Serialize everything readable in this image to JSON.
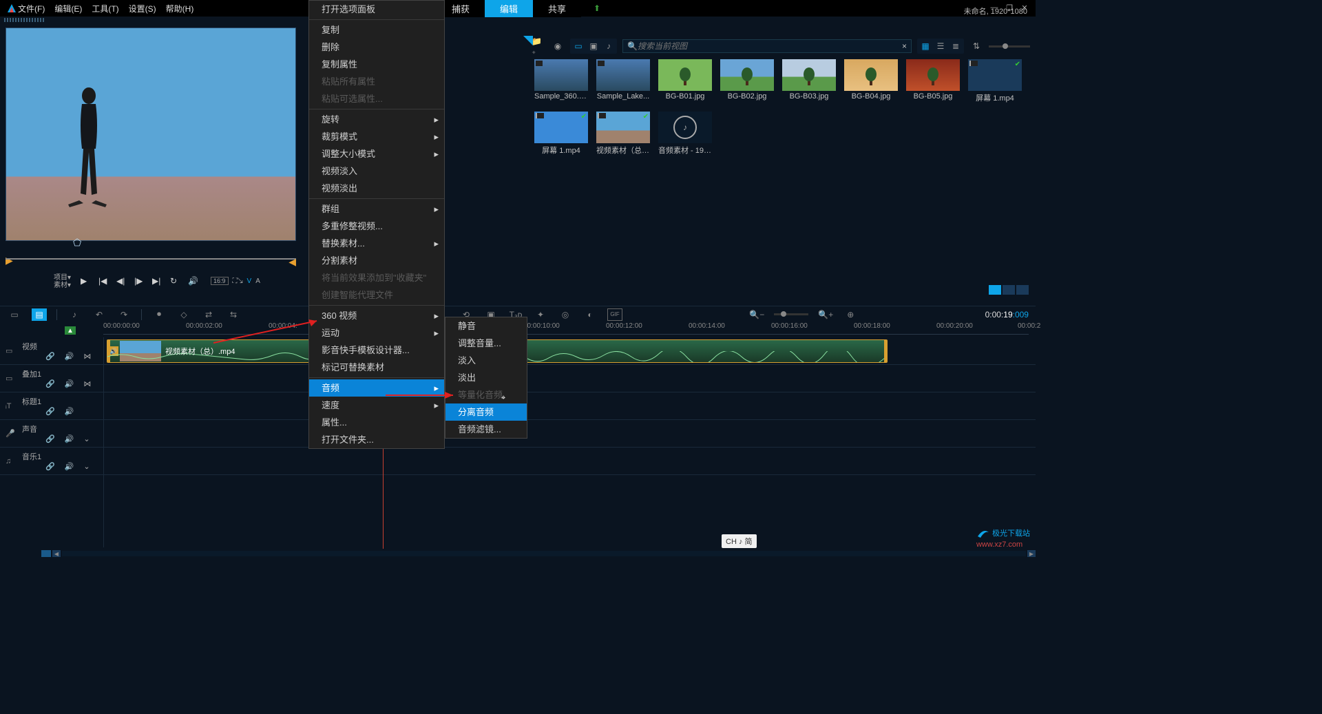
{
  "menu": {
    "file": "文件(F)",
    "edit": "编辑(E)",
    "tool": "工具(T)",
    "setting": "设置(S)",
    "help": "帮助(H)"
  },
  "modes": {
    "capture": "捕获",
    "edit": "编辑",
    "share": "共享"
  },
  "project": {
    "title": "未命名, 1920*1080"
  },
  "search": {
    "placeholder": "搜索当前视图",
    "icon": "search-icon",
    "clear": "×"
  },
  "thumbs": [
    {
      "name": "Sample_360.m...",
      "type": "spherical"
    },
    {
      "name": "Sample_Lake...",
      "type": "spherical"
    },
    {
      "name": "BG-B01.jpg",
      "type": "img",
      "bg": "linear-gradient(#7ab85a,#7ab85a)",
      "tree": true
    },
    {
      "name": "BG-B02.jpg",
      "type": "img",
      "bg": "linear-gradient(#6aa5d6 55%,#5a9a4a 55%)",
      "tree": true
    },
    {
      "name": "BG-B03.jpg",
      "type": "img",
      "bg": "linear-gradient(#b8cce0 55%,#5a9a4a 55%)",
      "tree": true
    },
    {
      "name": "BG-B04.jpg",
      "type": "img",
      "bg": "linear-gradient(#d8a860,#e8c080)",
      "tree": true
    },
    {
      "name": "BG-B05.jpg",
      "type": "img",
      "bg": "linear-gradient(#8a2a1a,#c0502a)",
      "tree": true
    },
    {
      "name": "屏幕 1.mp4",
      "type": "vid",
      "bg": "#1a3a5a",
      "check": true
    },
    {
      "name": "屏幕 1.mp4",
      "type": "vid",
      "bg": "#3a8ad8",
      "check": true
    },
    {
      "name": "视频素材（总）...",
      "type": "vid",
      "bg": "linear-gradient(#5aa5d6 60%,#a0826d 60%)",
      "check": true
    },
    {
      "name": "音频素材 - 196...",
      "type": "audio"
    }
  ],
  "ctx": {
    "open_opts": "打开选项面板",
    "copy": "复制",
    "delete": "删除",
    "copy_attr": "复制属性",
    "paste_all": "粘贴所有属性",
    "paste_opt": "粘贴可选属性...",
    "rotate": "旋转",
    "crop_mode": "裁剪模式",
    "resize_mode": "调整大小模式",
    "fade_in_v": "视频淡入",
    "fade_out_v": "视频淡出",
    "group": "群组",
    "multi_trim": "多重修整视频...",
    "replace": "替换素材...",
    "split": "分割素材",
    "add_fav": "将当前效果添加到\"收藏夹\"",
    "smart_proxy": "创建智能代理文件",
    "v360": "360 视频",
    "motion": "运动",
    "template": "影音快手模板设计器...",
    "mark_replace": "标记可替换素材",
    "audio": "音频",
    "speed": "速度",
    "props": "属性...",
    "open_folder": "打开文件夹..."
  },
  "sub": {
    "mute": "静音",
    "adj_vol": "调整音量...",
    "fade_in": "淡入",
    "fade_out": "淡出",
    "normalize": "等量化音频",
    "detach": "分离音频",
    "filter": "音频滤镜..."
  },
  "pc": {
    "proj": "项目",
    "source": "素材"
  },
  "ar": {
    "ratio": "16:9",
    "v": "V",
    "a": "A"
  },
  "tracks": {
    "video": "视频",
    "overlay": "叠加1",
    "title": "标题1",
    "voice": "声音",
    "music": "音乐1"
  },
  "timeline": {
    "ticks": [
      "00:00:00:00",
      "00:00:02:00",
      "00:00:04:",
      "00:00:10:00",
      "00:00:12:00",
      "00:00:14:00",
      "00:00:16:00",
      "00:00:18:00",
      "00:00:20:00",
      "00:00:2"
    ],
    "time_base": "0:00:",
    "time_sec": "19",
    "time_frm": ":009"
  },
  "clip": {
    "label": "视频素材（总）.mp4"
  },
  "ime": "CH ♪ 简",
  "watermark": {
    "brand": "极光下载站",
    "url": "www.xz7.com"
  }
}
